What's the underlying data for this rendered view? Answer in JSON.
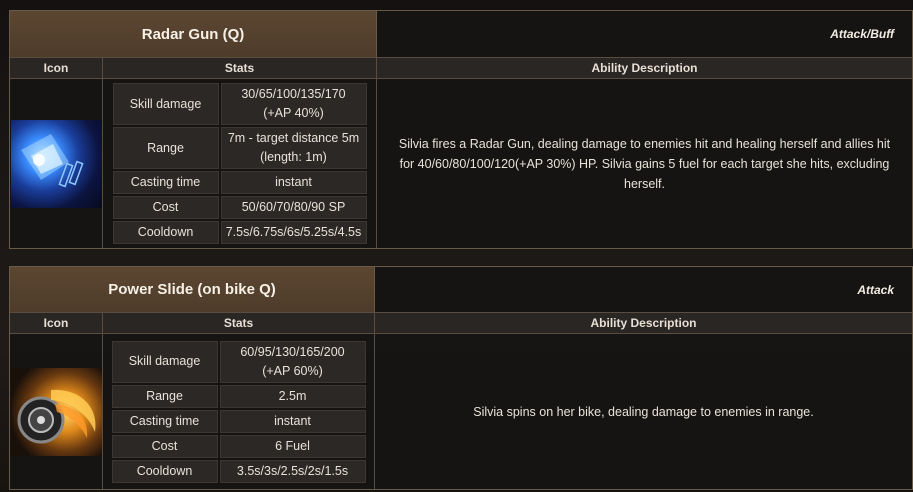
{
  "skills": [
    {
      "title": "Radar Gun (Q)",
      "type": "Attack/Buff",
      "headers": {
        "icon": "Icon",
        "stats": "Stats",
        "desc": "Ability Description"
      },
      "icon": "radar-gun-icon",
      "stats": [
        {
          "label": "Skill damage",
          "value": "30/65/100/135/170\n(+AP 40%)"
        },
        {
          "label": "Range",
          "value": "7m - target distance 5m\n(length: 1m)"
        },
        {
          "label": "Casting time",
          "value": "instant"
        },
        {
          "label": "Cost",
          "value": "50/60/70/80/90 SP"
        },
        {
          "label": "Cooldown",
          "value": "7.5s/6.75s/6s/5.25s/4.5s"
        }
      ],
      "description": "Silvia fires a Radar Gun, dealing damage to enemies hit and healing herself and allies hit for 40/60/80/100/120(+AP 30%) HP. Silvia gains 5 fuel for each target she hits, excluding herself."
    },
    {
      "title": "Power Slide (on bike Q)",
      "type": "Attack",
      "headers": {
        "icon": "Icon",
        "stats": "Stats",
        "desc": "Ability Description"
      },
      "icon": "power-slide-icon",
      "stats": [
        {
          "label": "Skill damage",
          "value": "60/95/130/165/200\n(+AP 60%)"
        },
        {
          "label": "Range",
          "value": "2.5m"
        },
        {
          "label": "Casting time",
          "value": "instant"
        },
        {
          "label": "Cost",
          "value": "6 Fuel"
        },
        {
          "label": "Cooldown",
          "value": "3.5s/3s/2.5s/2s/1.5s"
        }
      ],
      "description": "Silvia spins on her bike, dealing damage to enemies in range."
    }
  ]
}
